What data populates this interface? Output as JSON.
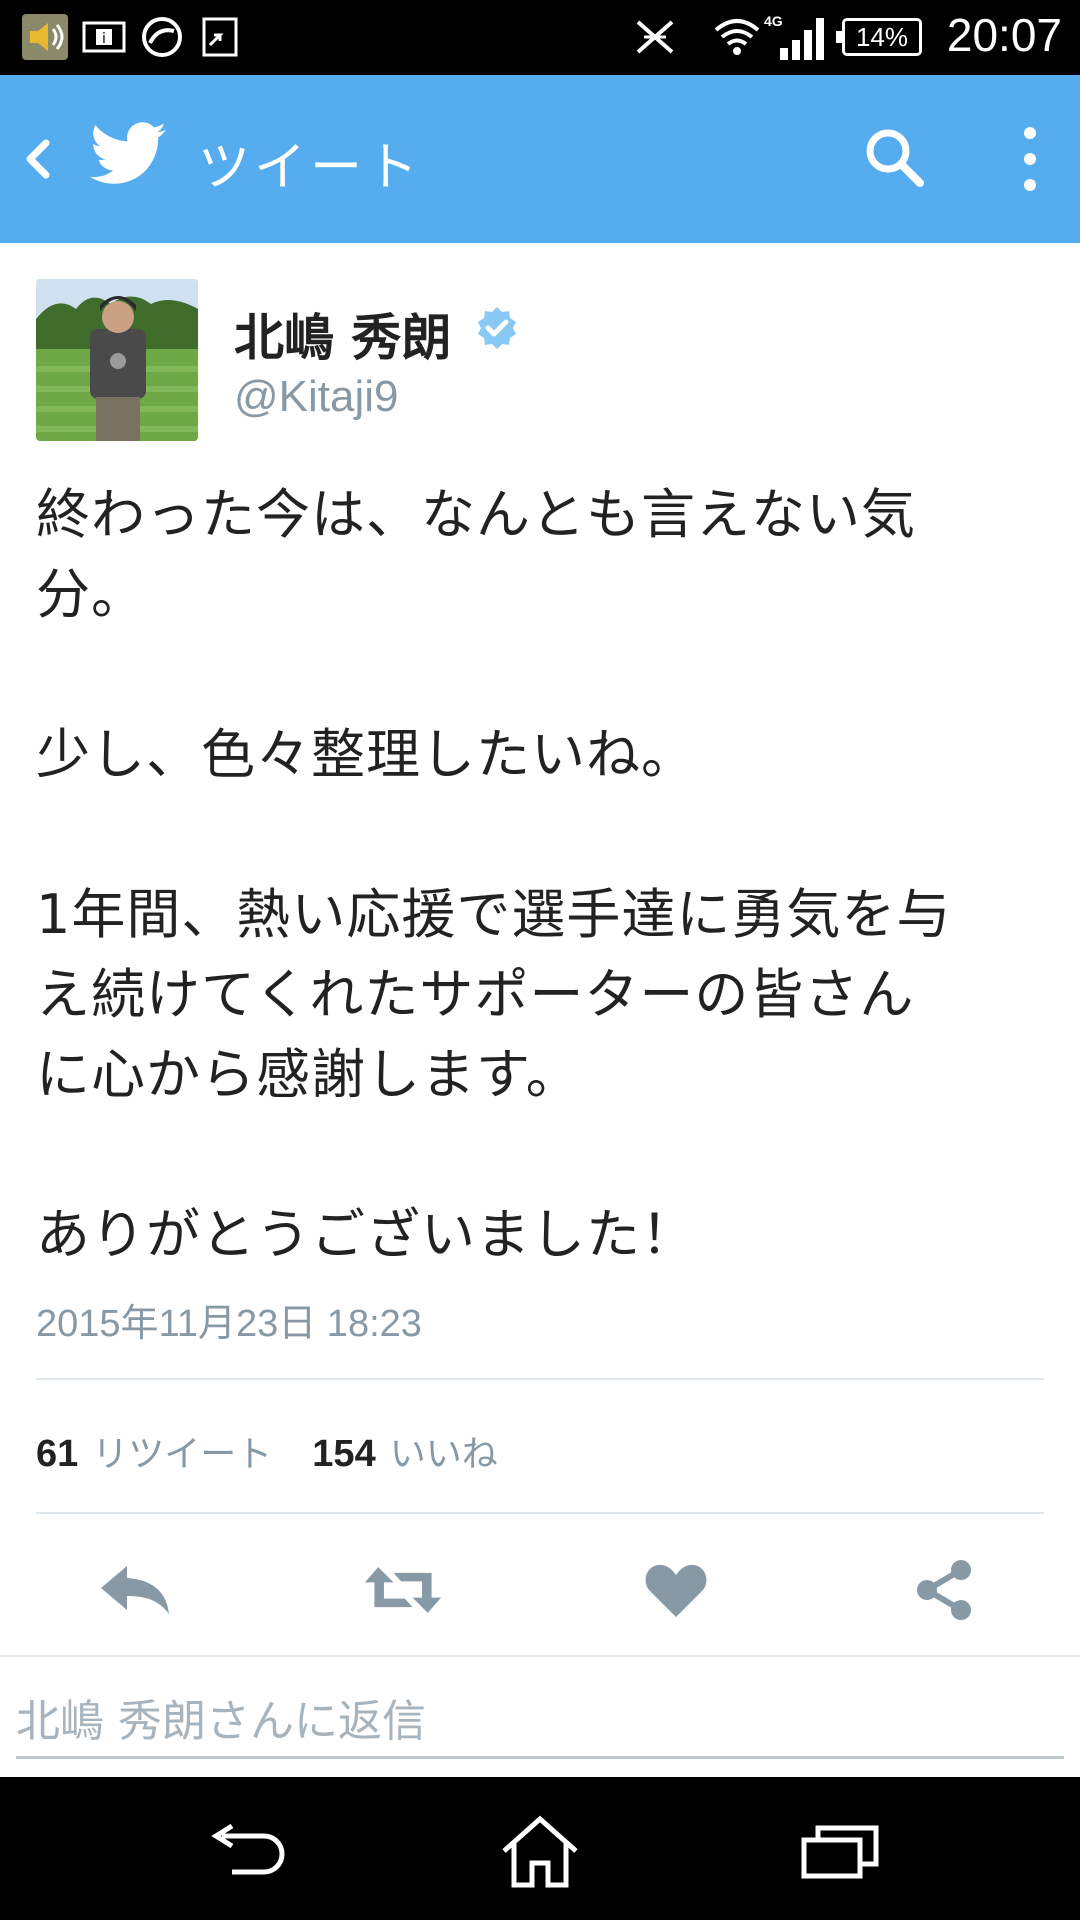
{
  "status_bar": {
    "time": "20:07",
    "battery": "14%",
    "network": "4G",
    "icons": [
      "volume-icon",
      "info-icon",
      "sync-icon",
      "share-app-icon",
      "no-nfc-icon",
      "wifi-icon",
      "signal-icon",
      "battery-icon"
    ]
  },
  "app_bar": {
    "title": "ツイート",
    "color": "#55acee",
    "icons": [
      "back-icon",
      "twitter-logo-icon",
      "search-icon",
      "more-vert-icon"
    ]
  },
  "tweet": {
    "author_name": "北嶋 秀朗",
    "author_handle": "@Kitaji9",
    "verified": true,
    "text": "終わった今は、なんとも言えない気\n分。\n\n少し、色々整理したいね。\n\n1年間、熱い応援で選手達に勇気を与\nえ続けてくれたサポーターの皆さん\nに心から感謝します。\n\nありがとうございました！",
    "timestamp": "2015年11月23日 18:23",
    "retweet_count": "61",
    "retweet_label": "リツイート",
    "like_count": "154",
    "like_label": "いいね"
  },
  "actions": [
    "reply-icon",
    "retweet-icon",
    "like-icon",
    "share-icon"
  ],
  "reply": {
    "placeholder": "北嶋 秀朗さんに返信"
  },
  "nav_bar": {
    "icons": [
      "nav-back-icon",
      "nav-home-icon",
      "nav-recents-icon"
    ]
  }
}
